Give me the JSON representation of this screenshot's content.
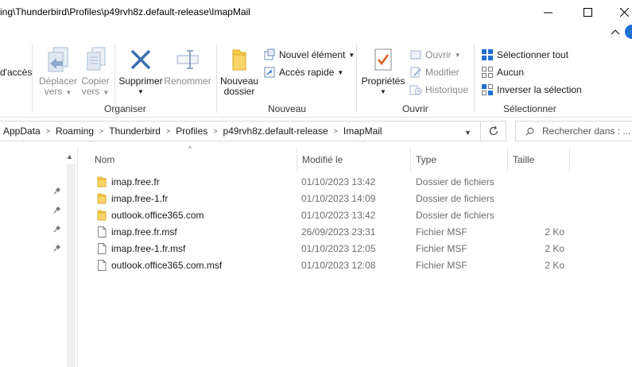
{
  "window": {
    "title": "ing\\Thunderbird\\Profiles\\p49rvh8z.default-release\\ImapMail"
  },
  "ribbon": {
    "partial_label": "d'accès",
    "organiser": {
      "label": "Organiser",
      "move_to": [
        "Déplacer",
        "vers"
      ],
      "copy_to": [
        "Copier",
        "vers"
      ],
      "delete": "Supprimer",
      "rename": "Renommer"
    },
    "nouveau": {
      "label": "Nouveau",
      "new_folder": [
        "Nouveau",
        "dossier"
      ],
      "new_item": "Nouvel élément",
      "quick_access": "Accès rapide"
    },
    "ouvrir": {
      "label": "Ouvrir",
      "properties": "Propriétés",
      "open": "Ouvrir",
      "edit": "Modifier",
      "history": "Historique"
    },
    "selection": {
      "label": "Sélectionner",
      "select_all": "Sélectionner tout",
      "select_none": "Aucun",
      "invert": "Inverser la sélection"
    }
  },
  "address": {
    "breadcrumbs": [
      "AppData",
      "Roaming",
      "Thunderbird",
      "Profiles",
      "p49rvh8z.default-release",
      "ImapMail"
    ],
    "search_placeholder": "Rechercher dans : ..."
  },
  "columns": {
    "name": "Nom",
    "modified": "Modifié le",
    "type": "Type",
    "size": "Taille"
  },
  "files": [
    {
      "name": "imap.free.fr",
      "modified": "01/10/2023 13:42",
      "type": "Dossier de fichiers",
      "size": "",
      "icon": "folder-icon"
    },
    {
      "name": "imap.free-1.fr",
      "modified": "01/10/2023 14:09",
      "type": "Dossier de fichiers",
      "size": "",
      "icon": "folder-icon"
    },
    {
      "name": "outlook.office365.com",
      "modified": "01/10/2023 13:42",
      "type": "Dossier de fichiers",
      "size": "",
      "icon": "folder-icon"
    },
    {
      "name": "imap.free.fr.msf",
      "modified": "26/09/2023 23:31",
      "type": "Fichier MSF",
      "size": "2 Ko",
      "icon": "file-icon"
    },
    {
      "name": "imap.free-1.fr.msf",
      "modified": "01/10/2023 12:05",
      "type": "Fichier MSF",
      "size": "2 Ko",
      "icon": "file-icon"
    },
    {
      "name": "outlook.office365.com.msf",
      "modified": "01/10/2023 12:08",
      "type": "Fichier MSF",
      "size": "2 Ko",
      "icon": "file-icon"
    }
  ],
  "colors": {
    "folder": "#f7c948",
    "accent": "#1f6fd1",
    "delete_x": "#3b6fb0"
  }
}
